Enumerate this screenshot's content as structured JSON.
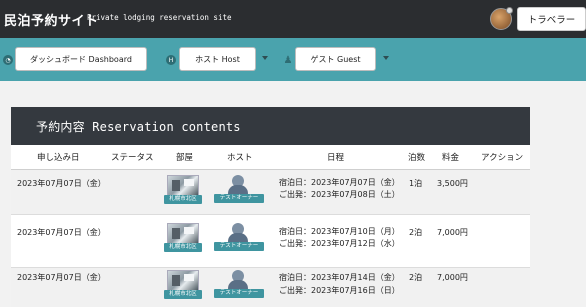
{
  "header": {
    "title": "民泊予約サイト",
    "subtitle": "Private lodging reservation site",
    "user_button": "トラベラー"
  },
  "nav": {
    "dashboard": "ダッシュボード Dashboard",
    "host": "ホスト Host",
    "guest": "ゲスト Guest"
  },
  "card": {
    "title": "予約内容 Reservation contents",
    "columns": [
      "申し込み日",
      "ステータス",
      "部屋",
      "ホスト",
      "日程",
      "泊数",
      "料金",
      "アクション"
    ]
  },
  "reservations": [
    {
      "applied": "2023年07月07日（金）",
      "status": "",
      "room": "札幌市北区",
      "host": "テストオーナー",
      "checkin": "宿泊日：2023年07月07日（金）",
      "checkout": "ご出発：2023年07月08日（土）",
      "nights": "1泊",
      "price": "3,500円"
    },
    {
      "applied": "2023年07月07日（金）",
      "status": "",
      "room": "札幌市北区",
      "host": "テストオーナー",
      "checkin": "宿泊日：2023年07月10日（月）",
      "checkout": "ご出発：2023年07月12日（水）",
      "nights": "2泊",
      "price": "7,000円"
    },
    {
      "applied": "2023年07月07日（金）",
      "status": "",
      "room": "札幌市北区",
      "host": "テストオーナー",
      "checkin": "宿泊日：2023年07月14日（金）",
      "checkout": "ご出発：2023年07月16日（日）",
      "nights": "2泊",
      "price": "7,000円"
    }
  ]
}
